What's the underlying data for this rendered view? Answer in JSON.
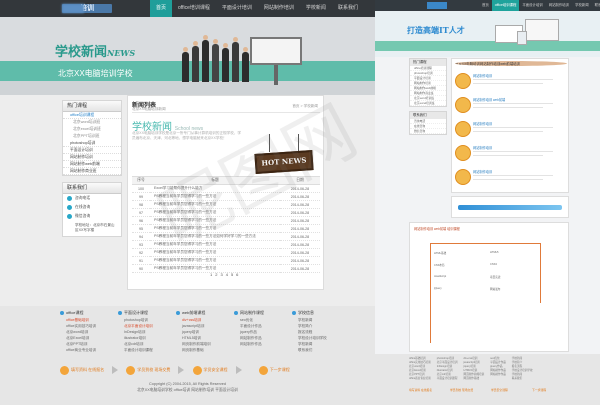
{
  "site": {
    "logo_text": "培训",
    "nav": [
      "首页",
      "office培训课程",
      "平面设计培训",
      "网站制作培训",
      "学校新闻",
      "联系我们"
    ]
  },
  "banner": {
    "title": "学校新闻",
    "title_en": "NEWS",
    "subtitle": "北京XX电脑培训学校"
  },
  "sidebar": {
    "heading": "热门课程",
    "items": [
      {
        "label": "office培训课程",
        "highlight": true
      },
      {
        "label": "北京word培训班",
        "sub": true
      },
      {
        "label": "北京excel培训班",
        "sub": true
      },
      {
        "label": "北京PPT培训班",
        "sub": true
      },
      {
        "label": "photoshop培训"
      },
      {
        "label": "平面设计培训"
      },
      {
        "label": "网站制作培训"
      },
      {
        "label": "网站制作web前端"
      },
      {
        "label": "网站制作商业班"
      }
    ],
    "contact_heading": "联系我们",
    "contact": [
      {
        "label": "咨询电话"
      },
      {
        "label": "在线咨询"
      },
      {
        "label": "微信咨询"
      }
    ],
    "address": "学校地址：北京市石景山区XX写字楼"
  },
  "main": {
    "title": "新闻列表",
    "subtitle": "北京XX电脑培训新闻",
    "breadcrumb": "首页 > 学校新闻",
    "hero": "学校新闻",
    "hero_en": "School news",
    "description": "北京XX电脑培训学校是北京一所专门从事计算机培训的正规学校，学员遍布北京、天津、河北等地，想学电脑就来北京XX学校！",
    "sign": "HOT NEWS",
    "columns": [
      "序号",
      "标题",
      "日期"
    ],
    "rows": [
      {
        "n": "100",
        "t": "Excel学习能帮你提升什么能力",
        "d": "2014-06-28"
      },
      {
        "n": "99",
        "t": "PS教程当前年学员您得学习的一些方法",
        "d": "2014-06-28"
      },
      {
        "n": "98",
        "t": "PS教程当前年学员您得学习的一些方法",
        "d": "2014-06-28"
      },
      {
        "n": "97",
        "t": "PS教程当前年学员您得学习的一些方法",
        "d": "2014-06-28"
      },
      {
        "n": "96",
        "t": "PS教程当前年学员您得学习的一些方法",
        "d": "2014-06-28"
      },
      {
        "n": "95",
        "t": "PS教程当前年学员您得学习的一些方法",
        "d": "2014-06-28"
      },
      {
        "n": "94",
        "t": "PS教程当前年学员您得学习的一些方法如何学好学习的一些方法",
        "d": "2014-06-28"
      },
      {
        "n": "93",
        "t": "PS教程当前年学员您得学习的一些方法",
        "d": "2014-06-28"
      },
      {
        "n": "92",
        "t": "PS教程当前年学员您得学习的一些方法",
        "d": "2014-06-28"
      },
      {
        "n": "91",
        "t": "PS教程当前年学员您得学习的一些方法",
        "d": "2014-06-28"
      },
      {
        "n": "90",
        "t": "PS教程当前年学员您得学习的一些方法",
        "d": "2014-06-28"
      }
    ],
    "pager": [
      "1",
      "2",
      "3",
      "4",
      "5",
      "6"
    ]
  },
  "footer": {
    "columns": [
      {
        "head": "office课程",
        "links": [
          "office基础培训",
          "office实用技巧培训",
          "北京word培训",
          "北京Excel培训",
          "北京PPT培训",
          "office商业专业培训"
        ],
        "red": [
          0
        ]
      },
      {
        "head": "平面设计课程",
        "links": [
          "photoshop培训",
          "北京平面设计培训",
          "InDesign培训",
          "illustrator培训",
          "北京cdr培训",
          "平面设计培训课程"
        ],
        "red": [
          1
        ]
      },
      {
        "head": "web前端课程",
        "links": [
          "div+css培训",
          "javascript培训",
          "jquery培训",
          "HTML5培训",
          "网页制作前端培训",
          "网页制作基础"
        ],
        "red": [
          0
        ]
      },
      {
        "head": "网站制作课程",
        "links": [
          "seo优化",
          "平面设计作品",
          "jquery作品",
          "网站制作作品",
          "网站制作作品"
        ],
        "red": []
      },
      {
        "head": "学校信息",
        "links": [
          "学校新闻",
          "学校简介",
          "报名流程",
          "学校设计培训学校",
          "学校新闻",
          "联系我们"
        ],
        "red": []
      }
    ],
    "steps": [
      "填写资料 在线报名",
      "学员到校 现场交费",
      "学员安全课程",
      "下一步课程"
    ],
    "copyright": "Copyright (C) 2004-2015, All Rights Reserved",
    "copyright2": "北京XX电脑培训学校 office培训 网站制作培训 平面设计培训"
  },
  "right": {
    "slogan": "打造高端IT人才",
    "main_head": "北京XX电脑培训网站制作培训web前端培训",
    "courses": [
      "网站制作培训",
      "网站制作培训 web前端",
      "网站制作培训",
      "网站制作培训",
      "网站制作培训"
    ],
    "diagram_title": "网站制作培训 web前端 培训课程",
    "diagram_labels": [
      "HTML基础",
      "CSS布局",
      "JavaScript",
      "jQuery",
      "HTML5",
      "CSS3",
      "项目实战",
      "网站发布"
    ],
    "steps": [
      "填写资料 在线报名",
      "学员到校 现场交费",
      "学员安全课程",
      "下一步课程"
    ]
  },
  "colors": {
    "accent": "#1f9e9a",
    "banner_band": "#5fbcaa",
    "link": "#1e7ec8",
    "step": "#f3a53b"
  }
}
